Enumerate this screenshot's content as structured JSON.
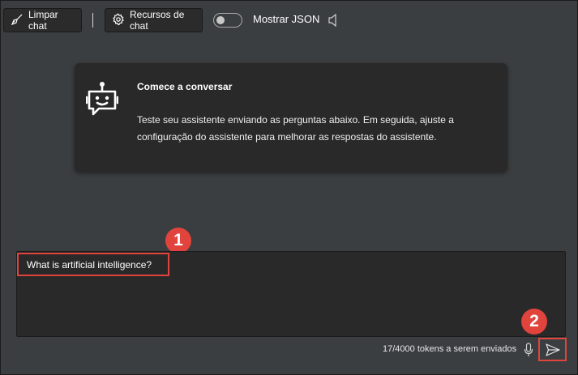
{
  "toolbar": {
    "clear_label": "Limpar chat",
    "resources_label": "Recursos de chat",
    "json_toggle_label": "Mostrar JSON",
    "json_toggle_on": false
  },
  "welcome": {
    "title": "Comece a conversar",
    "description": "Teste seu assistente enviando as perguntas abaixo. Em seguida, ajuste a configuração do assistente para melhorar as respostas do assistente."
  },
  "chat": {
    "input_value": "What is artificial intelligence?",
    "token_status": "17/4000 tokens a serem enviados"
  },
  "annotations": {
    "step1": "1",
    "step2": "2",
    "highlight_color": "#e0443c"
  },
  "icons": {
    "clear": "broom-icon",
    "resources": "gear-icon",
    "speaker": "speaker-icon",
    "bot": "bot-icon",
    "mic": "microphone-icon",
    "send": "send-icon"
  }
}
